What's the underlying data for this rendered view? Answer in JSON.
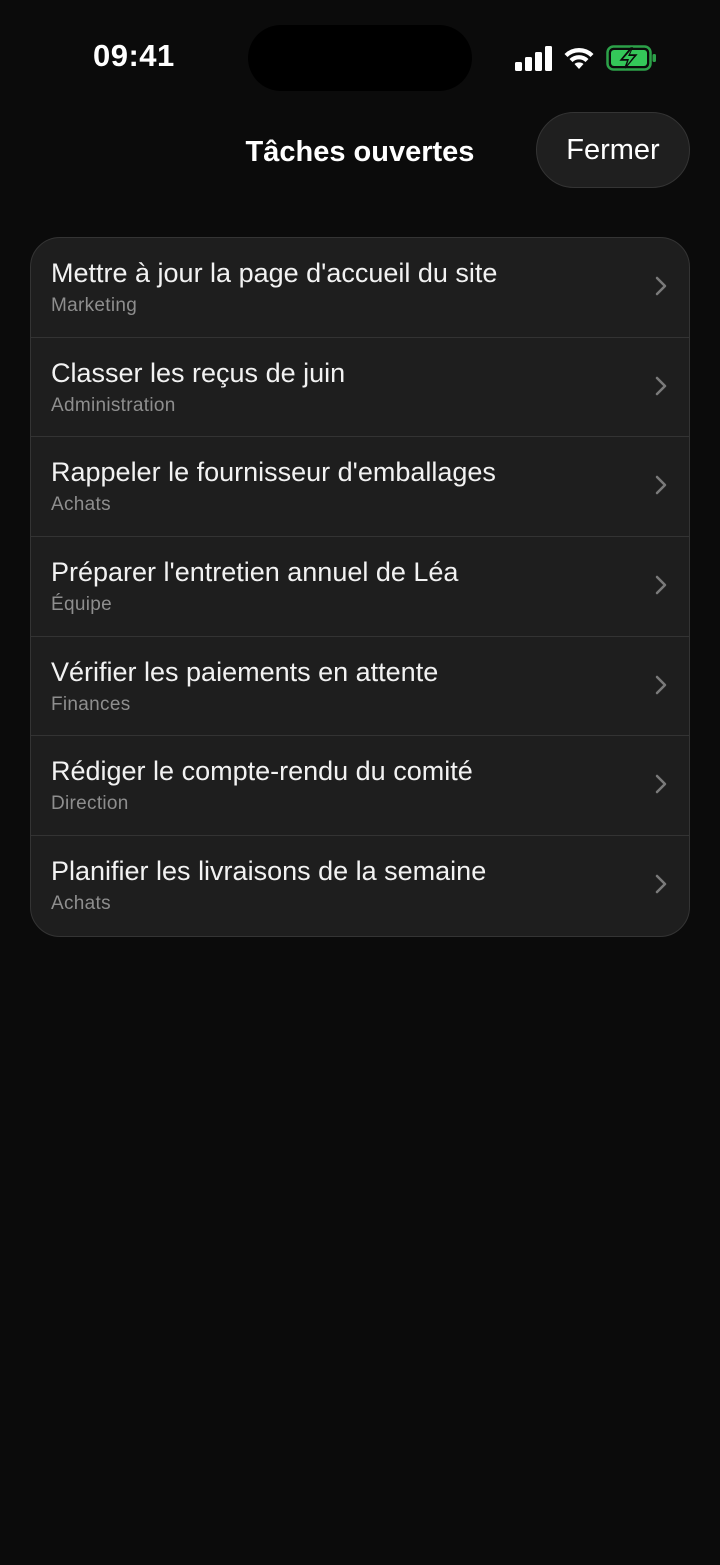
{
  "status_bar": {
    "time": "09:41",
    "signal_icon": "cellular-signal-icon",
    "wifi_icon": "wifi-icon",
    "battery_icon": "battery-charging-icon",
    "battery_color": "#34c759"
  },
  "header": {
    "title": "Tâches ouvertes",
    "close_label": "Fermer"
  },
  "tasks": [
    {
      "title": "Mettre à jour la page d'accueil du site",
      "category": "Marketing"
    },
    {
      "title": "Classer les reçus de juin",
      "category": "Administration"
    },
    {
      "title": "Rappeler le fournisseur d'emballages",
      "category": "Achats"
    },
    {
      "title": "Préparer l'entretien annuel de Léa",
      "category": "Équipe"
    },
    {
      "title": "Vérifier les paiements en attente",
      "category": "Finances"
    },
    {
      "title": "Rédiger le compte-rendu du comité",
      "category": "Direction"
    },
    {
      "title": "Planifier les livraisons de la semaine",
      "category": "Achats"
    }
  ],
  "colors": {
    "background": "#0b0b0b",
    "card": "#1e1e1e",
    "secondary_text": "#8e8e8e"
  }
}
